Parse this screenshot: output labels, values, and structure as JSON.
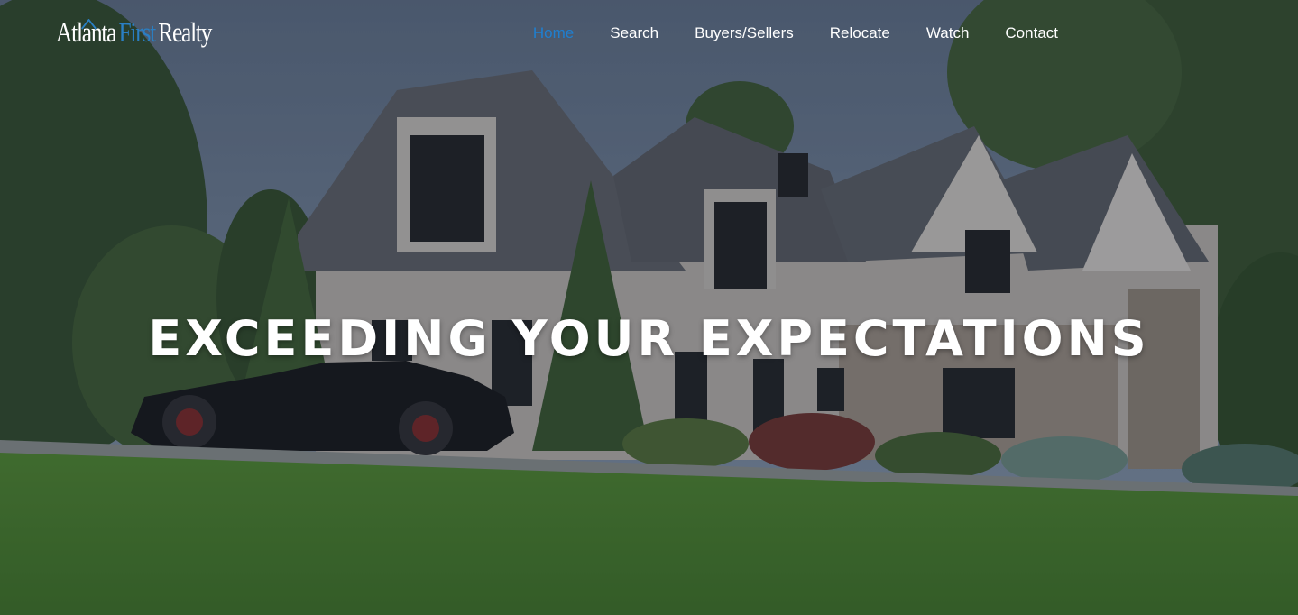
{
  "logo": {
    "word1": "Atl",
    "word1b": "nta",
    "word2": "First",
    "word3": "Realty"
  },
  "nav": {
    "items": [
      {
        "label": "Home",
        "active": true
      },
      {
        "label": "Search",
        "active": false
      },
      {
        "label": "Buyers/Sellers",
        "active": false
      },
      {
        "label": "Relocate",
        "active": false
      },
      {
        "label": "Watch",
        "active": false
      },
      {
        "label": "Contact",
        "active": false
      }
    ]
  },
  "hero": {
    "headline": "EXCEEDING YOUR EXPECTATIONS"
  },
  "colors": {
    "accent": "#1f7fd0",
    "logo_blue": "#2a7fc4",
    "text": "#ffffff"
  }
}
